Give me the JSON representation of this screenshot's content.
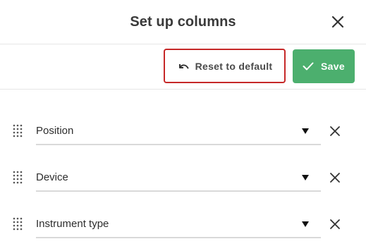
{
  "dialog": {
    "title": "Set up columns",
    "close_icon": "close-icon"
  },
  "toolbar": {
    "reset_label": "Reset to default",
    "reset_icon": "undo-icon",
    "reset_border_color": "#c62828",
    "save_label": "Save",
    "save_icon": "check-icon",
    "save_color": "#4caf6e"
  },
  "columns": [
    {
      "value": "Position",
      "handle_icon": "drag-handle-icon",
      "caret_icon": "caret-down-icon",
      "remove_icon": "remove-icon"
    },
    {
      "value": "Device",
      "handle_icon": "drag-handle-icon",
      "caret_icon": "caret-down-icon",
      "remove_icon": "remove-icon"
    },
    {
      "value": "Instrument type",
      "handle_icon": "drag-handle-icon",
      "caret_icon": "caret-down-icon",
      "remove_icon": "remove-icon"
    }
  ]
}
